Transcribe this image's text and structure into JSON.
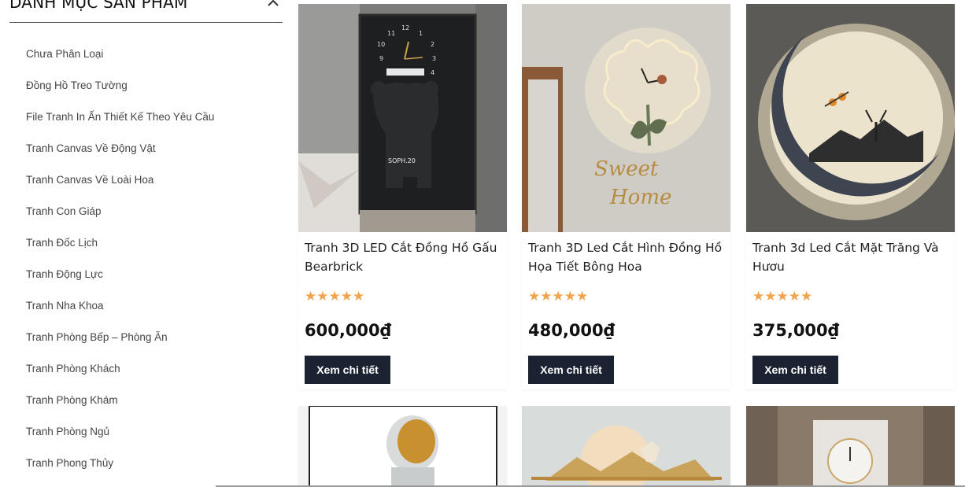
{
  "sidebar": {
    "title": "DANH MỤC SẢN PHẨM",
    "categories": [
      "Chưa Phân Loại",
      "Đồng Hồ Treo Tường",
      "File Tranh In Ấn Thiết Kế Theo Yêu Cầu",
      "Tranh Canvas Về Động Vật",
      "Tranh Canvas Về Loài Hoa",
      "Tranh Con Giáp",
      "Tranh Đốc Lịch",
      "Tranh Động Lực",
      "Tranh Nha Khoa",
      "Tranh Phòng Bếp – Phòng Ăn",
      "Tranh Phòng Khách",
      "Tranh Phòng Khám",
      "Tranh Phòng Ngủ",
      "Tranh Phong Thủy"
    ]
  },
  "products": [
    {
      "title": "Tranh 3D LED Cắt Đồng Hồ Gấu Bearbrick",
      "stars": "★★★★★",
      "rating": 5,
      "price": "600,000₫",
      "button": "Xem chi tiết",
      "image_text": "SOPH.20"
    },
    {
      "title": "Tranh 3D Led Cắt Hình Đồng Hồ Họa Tiết Bông Hoa",
      "stars": "★★★★★",
      "rating": 5,
      "price": "480,000₫",
      "button": "Xem chi tiết",
      "image_text_1": "Sweet",
      "image_text_2": "Home"
    },
    {
      "title": "Tranh 3d Led Cắt Mặt Trăng Và Hươu",
      "stars": "★★★★★",
      "rating": 5,
      "price": "375,000₫",
      "button": "Xem chi tiết"
    }
  ],
  "colors": {
    "star": "#f0a44b",
    "button_bg": "#1b2231",
    "button_text": "#ffffff"
  }
}
